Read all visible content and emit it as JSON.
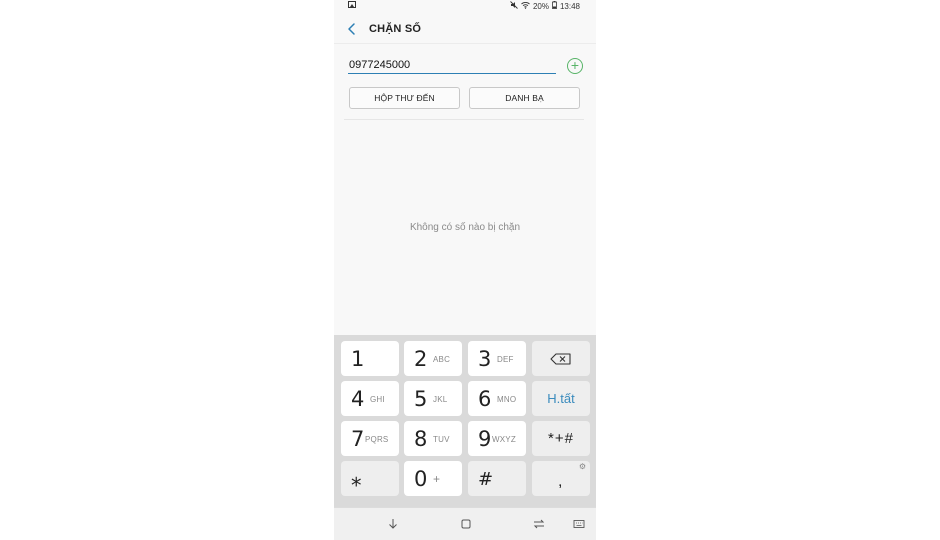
{
  "status": {
    "battery_percent": "20%",
    "time": "13:48"
  },
  "app": {
    "title": "CHẶN SỐ"
  },
  "input": {
    "number_value": "0977245000"
  },
  "buttons": {
    "inbox": "HỘP THƯ ĐẾN",
    "contacts": "DANH BẠ"
  },
  "empty_message": "Không có số nào bị chặn",
  "keypad": {
    "rows": [
      [
        {
          "digit": "1",
          "letters": ""
        },
        {
          "digit": "2",
          "letters": "ABC"
        },
        {
          "digit": "3",
          "letters": "DEF"
        },
        {
          "label": "backspace"
        }
      ],
      [
        {
          "digit": "4",
          "letters": "GHI"
        },
        {
          "digit": "5",
          "letters": "JKL"
        },
        {
          "digit": "6",
          "letters": "MNO"
        },
        {
          "label": "H.tất"
        }
      ],
      [
        {
          "digit": "7",
          "letters": "PQRS"
        },
        {
          "digit": "8",
          "letters": "TUV"
        },
        {
          "digit": "9",
          "letters": "WXYZ"
        },
        {
          "label": "*+#"
        }
      ],
      [
        {
          "digit": "⁎",
          "letters": ""
        },
        {
          "digit": "0",
          "letters": "+"
        },
        {
          "digit": "#",
          "letters": ""
        },
        {
          "label": ","
        }
      ]
    ]
  },
  "colors": {
    "accent": "#2d7fb4",
    "add_green": "#58b468",
    "keypad_bg": "#dadada"
  }
}
